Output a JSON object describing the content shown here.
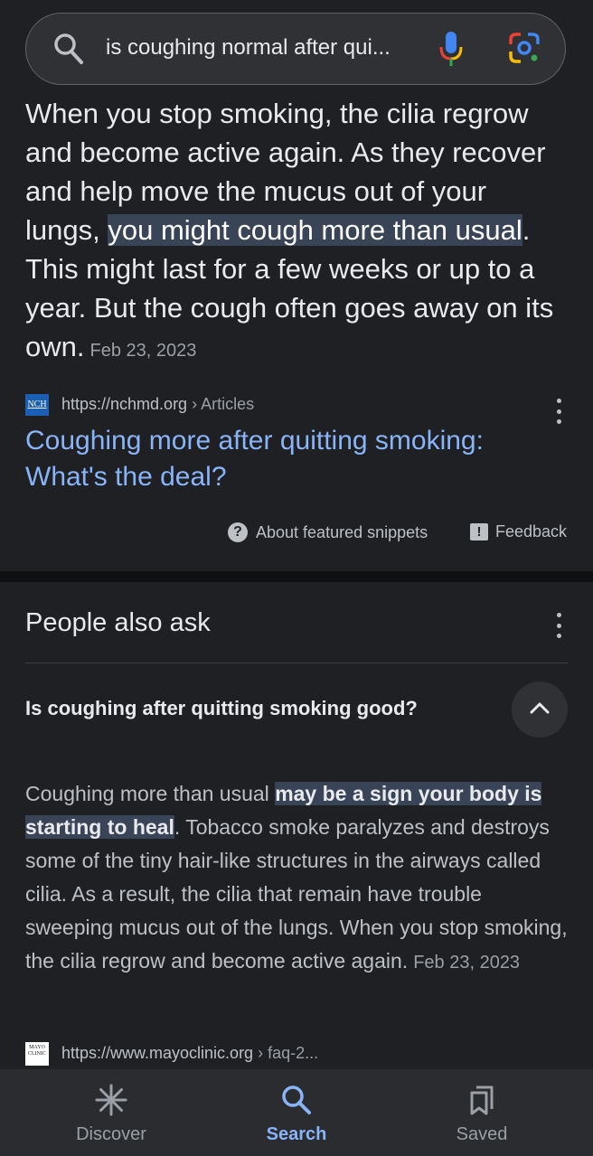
{
  "search": {
    "query": "is coughing normal after qui..."
  },
  "snippet": {
    "text_before": "When you stop smoking, the cilia regrow and become active again. As they recover and help move the mucus out of your lungs, ",
    "highlight": "you might cough more than usual",
    "text_after": ". This might last for a few weeks or up to a year. But the cough often goes away on its own.",
    "date": "Feb 23, 2023",
    "source_favicon_text": "NCH",
    "source_url": "https://nchmd.org",
    "source_path": " › Articles",
    "result_title": "Coughing more after quitting smoking: What's the deal?",
    "about_label": "About featured snippets",
    "feedback_label": "Feedback"
  },
  "people_also_ask": {
    "title": "People also ask",
    "question": "Is coughing after quitting smoking good?",
    "answer_before": "Coughing more than usual ",
    "answer_highlight": "may be a sign your body is starting to heal",
    "answer_after": ". Tobacco smoke paralyzes and destroys some of the tiny hair-like structures in the airways called cilia. As a result, the cilia that remain have trouble sweeping mucus out of the lungs. When you stop smoking, the cilia regrow and become active again.",
    "answer_date": "Feb 23, 2023",
    "source_favicon_text": "MAYO CLINIC",
    "source_url": "https://www.mayoclinic.org",
    "source_path": " › faq-2..."
  },
  "bottom_nav": {
    "items": [
      {
        "label": "Discover",
        "icon": "asterisk-icon",
        "active": false
      },
      {
        "label": "Search",
        "icon": "search-icon",
        "active": true
      },
      {
        "label": "Saved",
        "icon": "bookmarks-icon",
        "active": false
      }
    ]
  },
  "colors": {
    "background": "#1f2023",
    "link": "#8ab4f8",
    "highlight": "#394457",
    "active_nav": "#8ab4f8"
  }
}
